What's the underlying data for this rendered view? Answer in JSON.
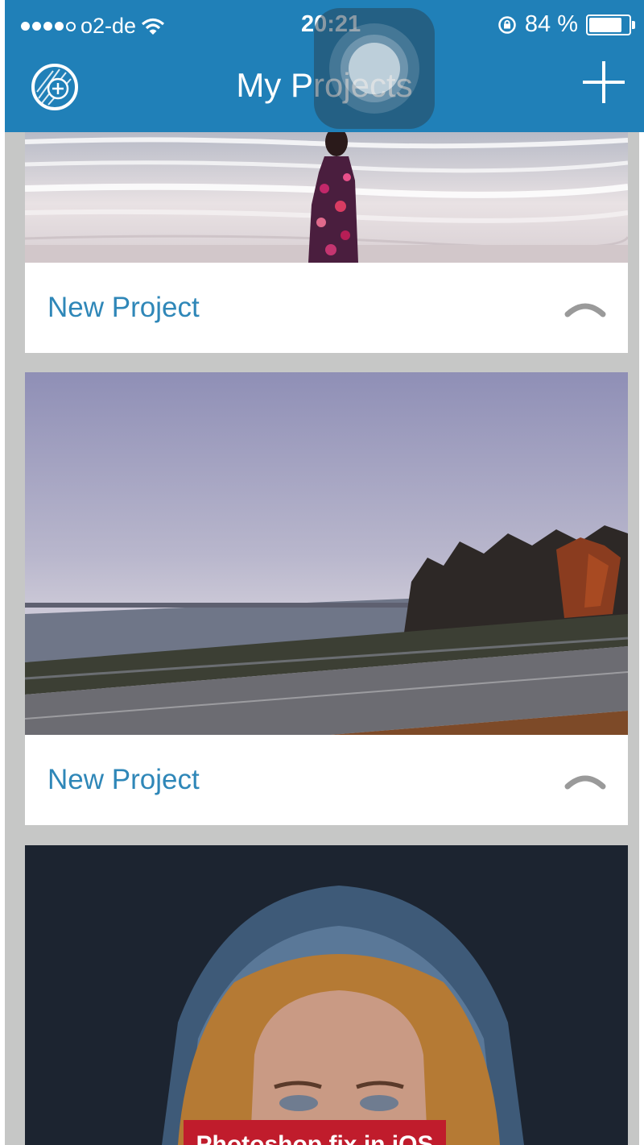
{
  "status_bar": {
    "carrier": "o2-de",
    "time": "20:21",
    "battery_percent_text": "84 %",
    "battery_level": 0.84,
    "icons": [
      "signal-dots-icon",
      "wifi-icon",
      "rotation-lock-icon",
      "battery-icon"
    ]
  },
  "nav": {
    "title": "My Projects",
    "left_icon": "add-circle-sketch-icon",
    "right_icon": "plus-icon"
  },
  "projects": [
    {
      "title": "New Project",
      "image": "woman in floral dress on beach",
      "chevron": "chevron-up-icon"
    },
    {
      "title": "New Project",
      "image": "coastal road under cloudy sky",
      "chevron": "chevron-up-icon"
    },
    {
      "title": "",
      "image": "woman in knitted hood",
      "chevron": ""
    }
  ],
  "overlay": {
    "assistive_touch": "assistive-touch-icon",
    "watermark": "Photoshop fix in iOS"
  },
  "colors": {
    "nav_bar": "#2080b8",
    "project_title": "#2f87b8",
    "background": "#c6c7c6",
    "watermark": "#c01c2c"
  }
}
